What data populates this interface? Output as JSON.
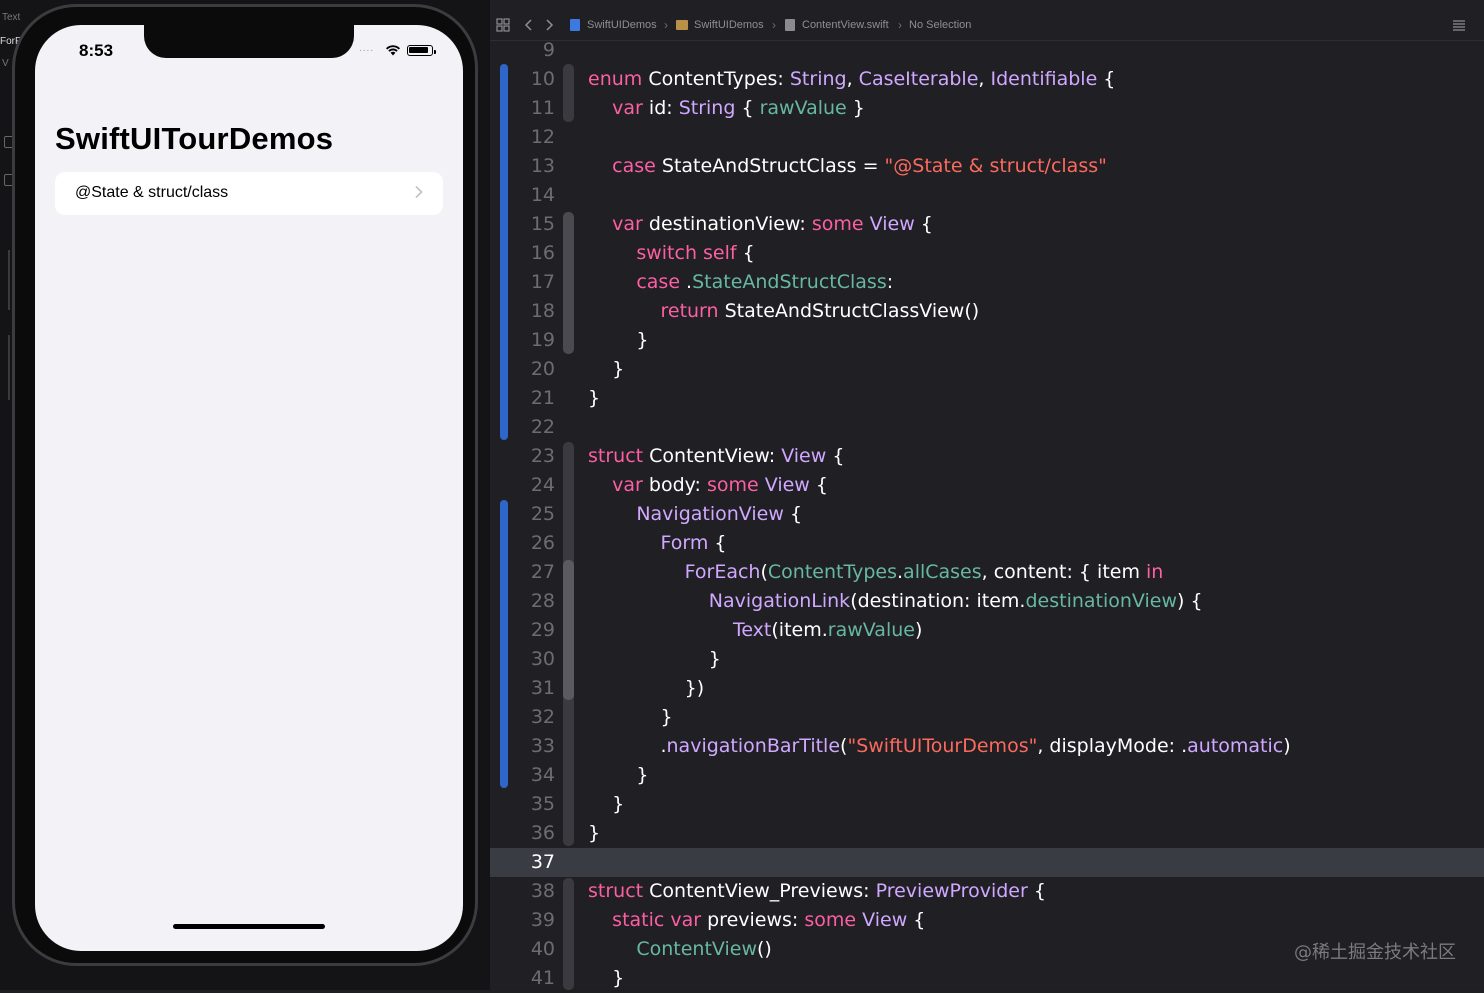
{
  "left_strip": {
    "label_text": "Text",
    "label_forf": "ForF",
    "label_v": "V"
  },
  "phone": {
    "status_time": "8:53",
    "status_dots": "....",
    "nav_title": "SwiftUITourDemos",
    "rows": [
      {
        "label": "@State & struct/class"
      }
    ]
  },
  "jumpbar": {
    "project": "SwiftUIDemos",
    "group": "SwiftUIDemos",
    "file": "ContentView.swift",
    "selection": "No Selection"
  },
  "editor": {
    "current_line": 37,
    "lines": [
      {
        "n": "9",
        "tokens": []
      },
      {
        "n": "10",
        "tokens": [
          [
            "kw",
            "enum "
          ],
          [
            "id",
            "ContentTypes: "
          ],
          [
            "ty",
            "String"
          ],
          [
            "pn",
            ", "
          ],
          [
            "ty",
            "CaseIterable"
          ],
          [
            "pn",
            ", "
          ],
          [
            "ty",
            "Identifiable"
          ],
          [
            "pn",
            " {"
          ]
        ]
      },
      {
        "n": "11",
        "tokens": [
          [
            "pn",
            "    "
          ],
          [
            "kw",
            "var "
          ],
          [
            "id",
            "id: "
          ],
          [
            "ty",
            "String"
          ],
          [
            "pn",
            " { "
          ],
          [
            "pr",
            "rawValue"
          ],
          [
            "pn",
            " }"
          ]
        ]
      },
      {
        "n": "12",
        "tokens": []
      },
      {
        "n": "13",
        "tokens": [
          [
            "pn",
            "    "
          ],
          [
            "kw",
            "case "
          ],
          [
            "id",
            "StateAndStructClass = "
          ],
          [
            "st",
            "\"@State & struct/class\""
          ]
        ]
      },
      {
        "n": "14",
        "tokens": []
      },
      {
        "n": "15",
        "tokens": [
          [
            "pn",
            "    "
          ],
          [
            "kw",
            "var "
          ],
          [
            "id",
            "destinationView: "
          ],
          [
            "kw",
            "some "
          ],
          [
            "ty",
            "View"
          ],
          [
            "pn",
            " {"
          ]
        ]
      },
      {
        "n": "16",
        "tokens": [
          [
            "pn",
            "        "
          ],
          [
            "kw",
            "switch self"
          ],
          [
            "pn",
            " {"
          ]
        ]
      },
      {
        "n": "17",
        "tokens": [
          [
            "pn",
            "        "
          ],
          [
            "kw",
            "case "
          ],
          [
            "pn",
            "."
          ],
          [
            "pr",
            "StateAndStructClass"
          ],
          [
            "pn",
            ":"
          ]
        ]
      },
      {
        "n": "18",
        "tokens": [
          [
            "pn",
            "            "
          ],
          [
            "kw",
            "return "
          ],
          [
            "id",
            "StateAndStructClassView()"
          ]
        ]
      },
      {
        "n": "19",
        "tokens": [
          [
            "pn",
            "        }"
          ]
        ]
      },
      {
        "n": "20",
        "tokens": [
          [
            "pn",
            "    }"
          ]
        ]
      },
      {
        "n": "21",
        "tokens": [
          [
            "pn",
            "}"
          ]
        ]
      },
      {
        "n": "22",
        "tokens": []
      },
      {
        "n": "23",
        "tokens": [
          [
            "kw",
            "struct "
          ],
          [
            "id",
            "ContentView: "
          ],
          [
            "ty",
            "View"
          ],
          [
            "pn",
            " {"
          ]
        ]
      },
      {
        "n": "24",
        "tokens": [
          [
            "pn",
            "    "
          ],
          [
            "kw",
            "var "
          ],
          [
            "id",
            "body: "
          ],
          [
            "kw",
            "some "
          ],
          [
            "ty",
            "View"
          ],
          [
            "pn",
            " {"
          ]
        ]
      },
      {
        "n": "25",
        "tokens": [
          [
            "pn",
            "        "
          ],
          [
            "ty",
            "NavigationView"
          ],
          [
            "pn",
            " {"
          ]
        ]
      },
      {
        "n": "26",
        "tokens": [
          [
            "pn",
            "            "
          ],
          [
            "ty",
            "Form"
          ],
          [
            "pn",
            " {"
          ]
        ]
      },
      {
        "n": "27",
        "tokens": [
          [
            "pn",
            "                "
          ],
          [
            "ty",
            "ForEach"
          ],
          [
            "pn",
            "("
          ],
          [
            "pr",
            "ContentTypes"
          ],
          [
            "pn",
            "."
          ],
          [
            "pr",
            "allCases"
          ],
          [
            "pn",
            ", content: { item "
          ],
          [
            "kw",
            "in"
          ]
        ]
      },
      {
        "n": "28",
        "tokens": [
          [
            "pn",
            "                    "
          ],
          [
            "ty",
            "NavigationLink"
          ],
          [
            "pn",
            "(destination: item."
          ],
          [
            "pr",
            "destinationView"
          ],
          [
            "pn",
            ") {"
          ]
        ]
      },
      {
        "n": "29",
        "tokens": [
          [
            "pn",
            "                        "
          ],
          [
            "ty",
            "Text"
          ],
          [
            "pn",
            "(item."
          ],
          [
            "pr",
            "rawValue"
          ],
          [
            "pn",
            ")"
          ]
        ]
      },
      {
        "n": "30",
        "tokens": [
          [
            "pn",
            "                    }"
          ]
        ]
      },
      {
        "n": "31",
        "tokens": [
          [
            "pn",
            "                })"
          ]
        ]
      },
      {
        "n": "32",
        "tokens": [
          [
            "pn",
            "            }"
          ]
        ]
      },
      {
        "n": "33",
        "tokens": [
          [
            "pn",
            "            ."
          ],
          [
            "ty",
            "navigationBarTitle"
          ],
          [
            "pn",
            "("
          ],
          [
            "st",
            "\"SwiftUITourDemos\""
          ],
          [
            "pn",
            ", displayMode: ."
          ],
          [
            "ty",
            "automatic"
          ],
          [
            "pn",
            ")"
          ]
        ]
      },
      {
        "n": "34",
        "tokens": [
          [
            "pn",
            "        }"
          ]
        ]
      },
      {
        "n": "35",
        "tokens": [
          [
            "pn",
            "    }"
          ]
        ]
      },
      {
        "n": "36",
        "tokens": [
          [
            "pn",
            "}"
          ]
        ]
      },
      {
        "n": "37",
        "tokens": []
      },
      {
        "n": "38",
        "tokens": [
          [
            "kw",
            "struct "
          ],
          [
            "id",
            "ContentView_Previews: "
          ],
          [
            "ty",
            "PreviewProvider"
          ],
          [
            "pn",
            " {"
          ]
        ]
      },
      {
        "n": "39",
        "tokens": [
          [
            "pn",
            "    "
          ],
          [
            "kw",
            "static var "
          ],
          [
            "id",
            "previews: "
          ],
          [
            "kw",
            "some "
          ],
          [
            "ty",
            "View"
          ],
          [
            "pn",
            " {"
          ]
        ]
      },
      {
        "n": "40",
        "tokens": [
          [
            "pn",
            "        "
          ],
          [
            "pr",
            "ContentView"
          ],
          [
            "pn",
            "()"
          ]
        ]
      },
      {
        "n": "41",
        "tokens": [
          [
            "pn",
            "    }"
          ]
        ]
      }
    ]
  },
  "colors": {
    "keyword": "#fc5fa3",
    "type": "#d0a8ff",
    "property": "#67b7a4",
    "string": "#fc6a5d",
    "change_bar": "#2f66c9"
  },
  "watermark": "@稀土掘金技术社区"
}
